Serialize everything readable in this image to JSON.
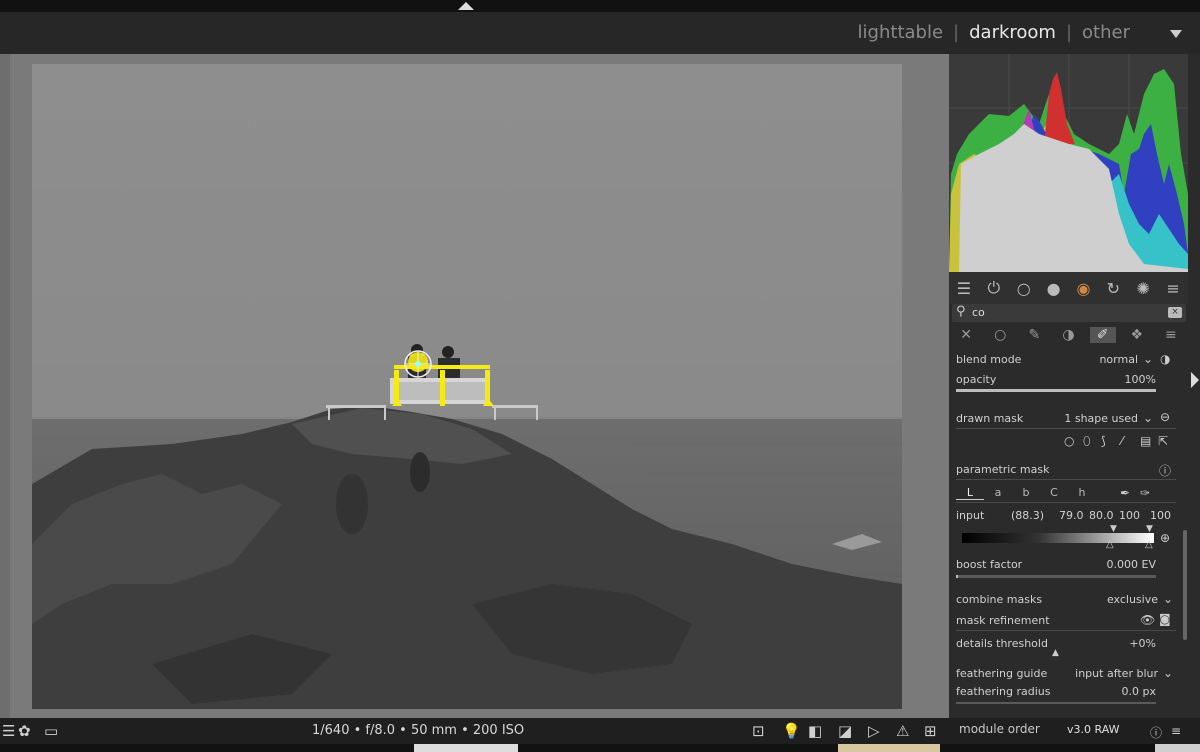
{
  "header": {
    "views": [
      "lighttable",
      "darkroom",
      "other"
    ],
    "active_view": "darkroom",
    "separator": "|"
  },
  "histogram": {
    "colors": {
      "red": "#d03030",
      "green": "#3cb043",
      "blue": "#3040c0",
      "cyan": "#36c2c8",
      "yellow": "#c8c33a",
      "magenta": "#b040b0",
      "white": "#cfcfcf"
    }
  },
  "module_groups": {
    "icons": [
      "sliders-icon",
      "power-icon",
      "circle-icon",
      "sphere-icon",
      "color-wheel-icon",
      "circular-arrows-icon",
      "aperture-icon",
      "menu-icon"
    ]
  },
  "search": {
    "value": "co",
    "clear": "⌫"
  },
  "mask_tabs": {
    "icons": [
      "off-icon",
      "uniform-icon",
      "drawn-icon",
      "parametric-icon",
      "drawn-parametric-icon",
      "raster-icon",
      "menu-icon"
    ],
    "active_index": 4
  },
  "blend": {
    "blend_mode_label": "blend mode",
    "blend_mode_value": "normal",
    "opacity_label": "opacity",
    "opacity_value": "100%",
    "opacity_level": 1.0
  },
  "drawn_mask": {
    "label": "drawn mask",
    "value": "1 shape used"
  },
  "parametric_mask": {
    "label": "parametric mask",
    "channels": [
      "L",
      "a",
      "b",
      "C",
      "h"
    ],
    "active_channel": "L",
    "input_label": "input",
    "input_values": [
      "(88.3)",
      "79.0",
      "80.0",
      "100",
      "100"
    ]
  },
  "boost_factor": {
    "label": "boost factor",
    "value": "0.000 EV"
  },
  "combine_masks": {
    "label": "combine masks",
    "value": "exclusive"
  },
  "mask_refinement": {
    "label": "mask refinement"
  },
  "details_threshold": {
    "label": "details threshold",
    "value": "+0%",
    "level": 0.5
  },
  "feathering_guide": {
    "label": "feathering guide",
    "value": "input after blur"
  },
  "feathering_radius": {
    "label": "feathering radius",
    "value": "0.0 px"
  },
  "bottom": {
    "exif": "1/640 • f/8.0 • 50 mm • 200 ISO",
    "module_order_label": "module order",
    "module_order_value": "v3.0 RAW"
  }
}
